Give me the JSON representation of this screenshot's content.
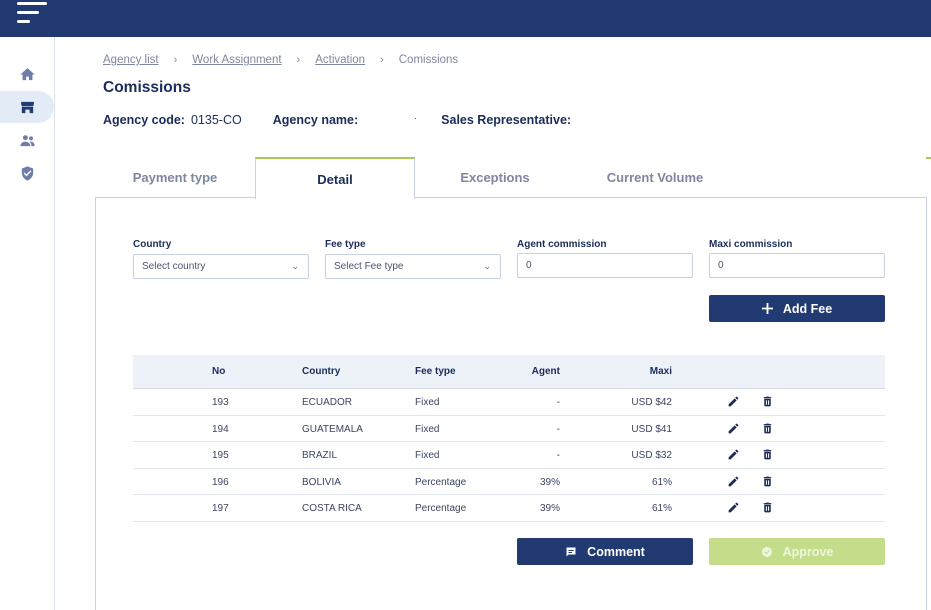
{
  "breadcrumb": {
    "items": [
      "Agency list",
      "Work Assignment",
      "Activation"
    ],
    "current": "Comissions",
    "separator": "›"
  },
  "page": {
    "title": "Comissions"
  },
  "agency": {
    "code_label": "Agency code:",
    "code_value": "0135-CO",
    "name_label": "Agency name:",
    "name_value": "·",
    "sales_label": "Sales Representative:",
    "sales_value": ""
  },
  "tabs": [
    "Payment type",
    "Detail",
    "Exceptions",
    "Current Volume"
  ],
  "active_tab": "Detail",
  "form": {
    "country_label": "Country",
    "country_placeholder": "Select country",
    "fee_type_label": "Fee type",
    "fee_type_placeholder": "Select Fee type",
    "agent_label": "Agent commission",
    "agent_value": "0",
    "maxi_label": "Maxi commission",
    "maxi_value": "0",
    "add_fee_label": "Add Fee"
  },
  "table": {
    "headers": [
      "No",
      "Country",
      "Fee type",
      "Agent",
      "Maxi"
    ],
    "rows": [
      {
        "no": "193",
        "country": "ECUADOR",
        "fee_type": "Fixed",
        "agent": "-",
        "maxi": "USD $42"
      },
      {
        "no": "194",
        "country": "GUATEMALA",
        "fee_type": "Fixed",
        "agent": "-",
        "maxi": "USD $41"
      },
      {
        "no": "195",
        "country": "BRAZIL",
        "fee_type": "Fixed",
        "agent": "-",
        "maxi": "USD $32"
      },
      {
        "no": "196",
        "country": "BOLIVIA",
        "fee_type": "Percentage",
        "agent": "39%",
        "maxi": "61%"
      },
      {
        "no": "197",
        "country": "COSTA RICA",
        "fee_type": "Percentage",
        "agent": "39%",
        "maxi": "61%"
      }
    ]
  },
  "actions": {
    "comment_label": "Comment",
    "approve_label": "Approve"
  },
  "icons": {
    "menu": "hamburger-menu-icon",
    "home": "home-icon",
    "store": "store-icon",
    "users": "users-icon",
    "shield": "shield-check-icon",
    "plus": "plus-icon",
    "edit": "pencil-icon",
    "delete": "trash-icon",
    "comment": "comment-icon",
    "approve": "check-circle-icon"
  },
  "colors": {
    "primary": "#223a72",
    "accent": "#a6cc52",
    "approve_disabled": "#c3dd8b",
    "table_header_bg": "#edf2f9"
  }
}
